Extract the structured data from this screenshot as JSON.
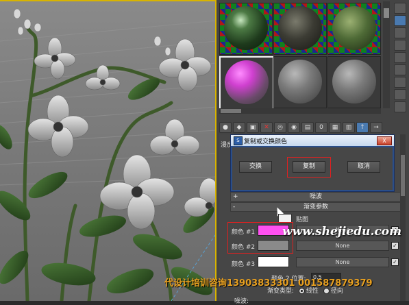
{
  "material_editor": {
    "slots": [
      {
        "name": "slot-1",
        "sphere": "dark-green-glossy"
      },
      {
        "name": "slot-2",
        "sphere": "dark-rock-texture"
      },
      {
        "name": "slot-3",
        "sphere": "green-mossy"
      },
      {
        "name": "slot-4",
        "sphere": "magenta-gradient"
      },
      {
        "name": "slot-5",
        "sphere": "grey-default"
      },
      {
        "name": "slot-6",
        "sphere": "grey-default"
      }
    ],
    "side_label": "漫反",
    "rollouts": {
      "noise_header": "噪波",
      "noise_toggle": "+",
      "gradient_header": "渐变参数",
      "gradient_toggle": "-",
      "map_label": "贴图",
      "color1_label": "颜色 #1",
      "color1_map": "None",
      "color2_label": "颜色 #2",
      "color2_map": "None",
      "color3_label": "颜色 #3",
      "color3_map": "None",
      "color2_position_label": "颜色 2 位置:",
      "color2_position_value": "0.5",
      "gradient_type_label": "渐变类型:",
      "type_linear": "线性",
      "type_radial": "径向",
      "bottom_label": "噪波:"
    },
    "colors": {
      "color1": "#ff50f0",
      "color2": "#8a8a8a",
      "color3": "#ffffff"
    }
  },
  "dialog": {
    "title": "复制或交换颜色",
    "close": "X",
    "swap_button": "交换",
    "copy_button": "复制",
    "cancel_button": "取消"
  },
  "watermarks": {
    "url": "www.shejiedu.com",
    "ad": "代设计培训咨询13903833301 001587879379"
  }
}
